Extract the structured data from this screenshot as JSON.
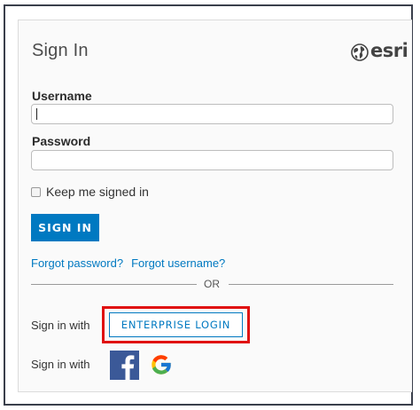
{
  "header": {
    "title": "Sign In",
    "logo_text": "esri",
    "logo_icon": "globe-icon"
  },
  "form": {
    "username_label": "Username",
    "username_value": "",
    "password_label": "Password",
    "password_value": "",
    "keep_signed_in_label": "Keep me signed in",
    "keep_signed_in_checked": false,
    "sign_in_button": "SIGN IN"
  },
  "links": {
    "forgot_password": "Forgot password?",
    "forgot_username": "Forgot username?"
  },
  "divider": {
    "label": "OR"
  },
  "alternatives": {
    "sign_in_with_1": "Sign in with",
    "enterprise_button": "ENTERPRISE LOGIN",
    "sign_in_with_2": "Sign in with",
    "social_icons": [
      "facebook-icon",
      "google-icon"
    ]
  },
  "colors": {
    "accent": "#0079c1",
    "highlight": "#e01010",
    "facebook": "#3b5998"
  }
}
